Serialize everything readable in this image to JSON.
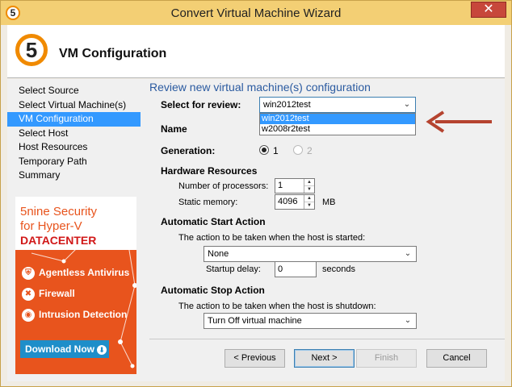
{
  "window": {
    "title": "Convert Virtual Machine Wizard",
    "app_icon_text": "5",
    "close_glyph": "✕"
  },
  "header": {
    "logo_text": "5",
    "title": "VM Configuration"
  },
  "nav": {
    "items": [
      {
        "label": "Select Source",
        "active": false
      },
      {
        "label": "Select Virtual Machine(s)",
        "active": false
      },
      {
        "label": "VM Configuration",
        "active": true
      },
      {
        "label": "Select Host",
        "active": false
      },
      {
        "label": "Host Resources",
        "active": false
      },
      {
        "label": "Temporary Path",
        "active": false
      },
      {
        "label": "Summary",
        "active": false
      }
    ]
  },
  "ad": {
    "line1": "5nine Security",
    "line2": "for Hyper-V",
    "line3": "DATACENTER",
    "features": [
      {
        "label": "Agentless Antivirus",
        "icon": "shield-icon"
      },
      {
        "label": "Firewall",
        "icon": "firewall-icon"
      },
      {
        "label": "Intrusion Detection",
        "icon": "intrusion-icon"
      }
    ],
    "cta": "Download Now"
  },
  "form": {
    "section_title": "Review new virtual machine(s) configuration",
    "select_for_review_label": "Select for review:",
    "select_for_review_value": "win2012test",
    "dropdown_options": [
      "win2012test",
      "w2008r2test"
    ],
    "name_label": "Name",
    "generation_label": "Generation:",
    "generation_options": [
      "1",
      "2"
    ],
    "hardware_title": "Hardware Resources",
    "processors_label": "Number of processors:",
    "processors_value": "1",
    "memory_label": "Static memory:",
    "memory_value": "4096",
    "memory_unit": "MB",
    "start_title": "Automatic Start Action",
    "start_desc": "The action to be taken when the host is started:",
    "start_value": "None",
    "startup_delay_label": "Startup delay:",
    "startup_delay_value": "0",
    "startup_delay_unit": "seconds",
    "stop_title": "Automatic Stop Action",
    "stop_desc": "The action to be taken when the host is shutdown:",
    "stop_value": "Turn Off virtual machine"
  },
  "buttons": {
    "previous": "< Previous",
    "next": "Next >",
    "finish": "Finish",
    "cancel": "Cancel"
  },
  "colors": {
    "titlebar": "#f3cf74",
    "nav_active": "#3399ff",
    "ad_orange": "#e8541d",
    "arrow": "#b5432f",
    "section_title": "#2a5aa0"
  }
}
